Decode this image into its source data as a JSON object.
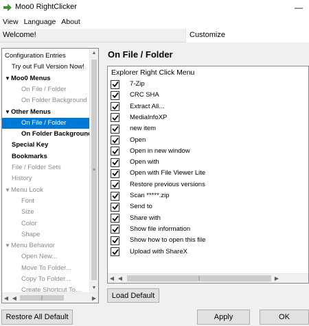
{
  "window": {
    "title": "Moo0 RightClicker",
    "minimize_glyph": "—",
    "app_icon": "green-arrow-icon"
  },
  "menubar": {
    "items": [
      "View",
      "Language",
      "About"
    ]
  },
  "header": {
    "welcome": "Welcome!",
    "customize": "Customize"
  },
  "tree": {
    "items": [
      {
        "label": "Configuration Entries",
        "style": "normal",
        "indent": 0
      },
      {
        "label": "Try out Full Version Now!",
        "style": "normal",
        "indent": 1
      },
      {
        "label": "Moo0 Menus",
        "style": "bold",
        "indent": 0,
        "expander": "▼"
      },
      {
        "label": "On File / Folder",
        "style": "gray",
        "indent": 2
      },
      {
        "label": "On Folder Background",
        "style": "gray",
        "indent": 2
      },
      {
        "label": "Other Menus",
        "style": "bold",
        "indent": 0,
        "expander": "▼"
      },
      {
        "label": "On File / Folder",
        "style": "selected",
        "indent": 2
      },
      {
        "label": "On Folder Background",
        "style": "bold",
        "indent": 2
      },
      {
        "label": "Special Key",
        "style": "bold",
        "indent": 1
      },
      {
        "label": "Bookmarks",
        "style": "bold",
        "indent": 1
      },
      {
        "label": "File / Folder Sets",
        "style": "gray",
        "indent": 1
      },
      {
        "label": "History",
        "style": "gray",
        "indent": 1
      },
      {
        "label": "Menu Look",
        "style": "gray",
        "indent": 0,
        "expander": "▼"
      },
      {
        "label": "Font",
        "style": "gray",
        "indent": 2
      },
      {
        "label": "Size",
        "style": "gray",
        "indent": 2
      },
      {
        "label": "Color",
        "style": "gray",
        "indent": 2
      },
      {
        "label": "Shape",
        "style": "gray",
        "indent": 2
      },
      {
        "label": "Menu Behavior",
        "style": "gray",
        "indent": 0,
        "expander": "▼"
      },
      {
        "label": "Open New...",
        "style": "gray",
        "indent": 2
      },
      {
        "label": "Move To Folder...",
        "style": "gray",
        "indent": 2
      },
      {
        "label": "Copy To Folder...",
        "style": "gray",
        "indent": 2
      },
      {
        "label": "Create Shortcut To...",
        "style": "gray",
        "indent": 2
      }
    ]
  },
  "content": {
    "title": "On File / Folder",
    "list_header": "Explorer Right Click Menu",
    "items": [
      {
        "label": "7-Zip",
        "checked": true
      },
      {
        "label": "CRC SHA",
        "checked": true
      },
      {
        "label": "Extract All...",
        "checked": true
      },
      {
        "label": "MediaInfoXP",
        "checked": true
      },
      {
        "label": "new item",
        "checked": true
      },
      {
        "label": "Open",
        "checked": true
      },
      {
        "label": "Open in new window",
        "checked": true
      },
      {
        "label": "Open with",
        "checked": true
      },
      {
        "label": "Open with File Viewer Lite",
        "checked": true
      },
      {
        "label": "Restore previous versions",
        "checked": true
      },
      {
        "label": "Scan *****.zip",
        "checked": true
      },
      {
        "label": "Send to",
        "checked": true
      },
      {
        "label": "Share with",
        "checked": true
      },
      {
        "label": "Show file information",
        "checked": true
      },
      {
        "label": "Show how to open this file",
        "checked": true
      },
      {
        "label": "Upload with ShareX",
        "checked": true
      }
    ],
    "load_default": "Load Default"
  },
  "buttons": {
    "restore_all": "Restore All Default",
    "apply": "Apply",
    "ok": "OK"
  },
  "colors": {
    "selection": "#0078d7",
    "check": "#000000",
    "arrow_icon": "#3a9a2b"
  }
}
